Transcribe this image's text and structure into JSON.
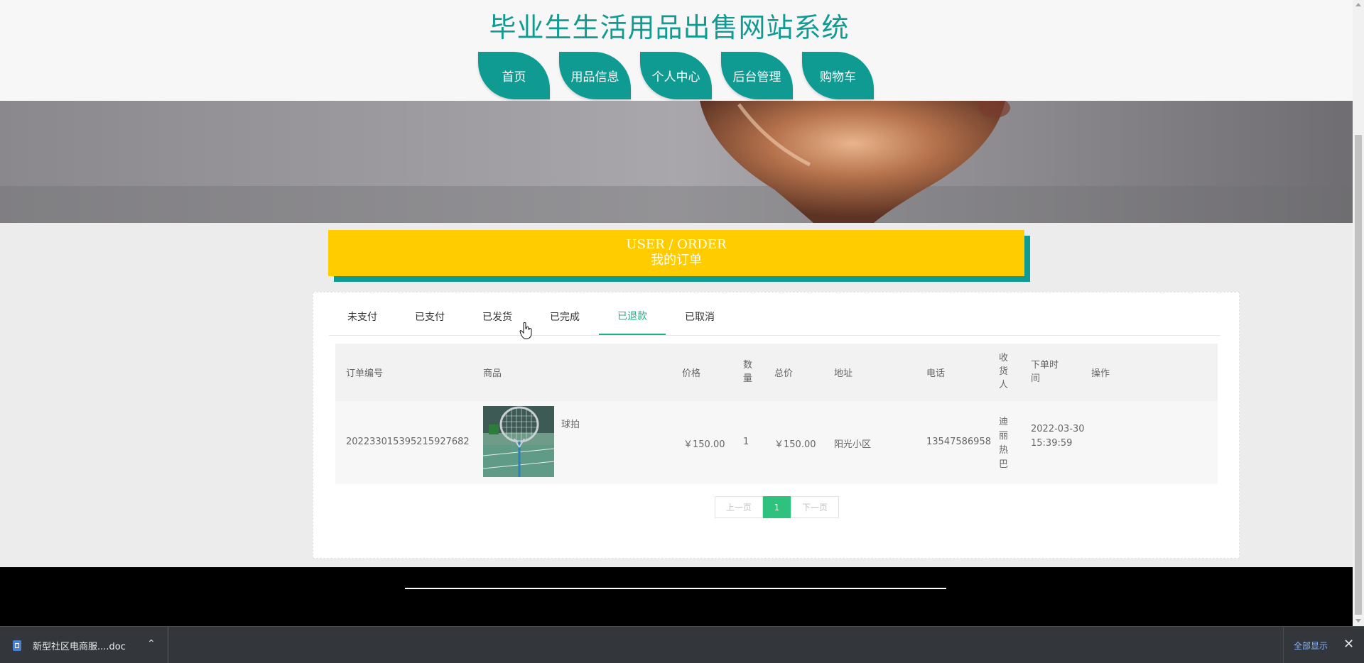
{
  "header": {
    "site_title": "毕业生生活用品出售网站系统",
    "nav": [
      "首页",
      "用品信息",
      "个人中心",
      "后台管理",
      "购物车"
    ]
  },
  "banner": {
    "icon": "trophy-banner-image"
  },
  "order_section": {
    "title_en": "USER / ORDER",
    "title_cn": "我的订单"
  },
  "tabs": {
    "items": [
      "未支付",
      "已支付",
      "已发货",
      "已完成",
      "已退款",
      "已取消"
    ],
    "active": "已退款"
  },
  "table": {
    "headers": {
      "order_no": "订单编号",
      "product": "商品",
      "price": "价格",
      "qty": "数量",
      "total": "总价",
      "address": "地址",
      "phone": "电话",
      "receiver": "收货人",
      "order_time": "下单时间",
      "action": "操作"
    },
    "rows": [
      {
        "order_no": "202233015395215927682",
        "product_name": "球拍",
        "product_image": "badminton-racket-image",
        "price": "￥150.00",
        "qty": "1",
        "total": "￥150.00",
        "address": "阳光小区",
        "phone": "13547586958",
        "receiver": "迪丽热巴",
        "order_time": "2022-03-30 15:39:59"
      }
    ]
  },
  "pager": {
    "prev": "上一页",
    "current": "1",
    "next": "下一页"
  },
  "download_bar": {
    "file_name": "新型社区电商服....doc",
    "show_all": "全部显示"
  },
  "colors": {
    "brand_teal": "#0f9a92",
    "title_yellow": "#ffcc00",
    "active_green": "#21ae86",
    "pager_green": "#2fc17e"
  }
}
